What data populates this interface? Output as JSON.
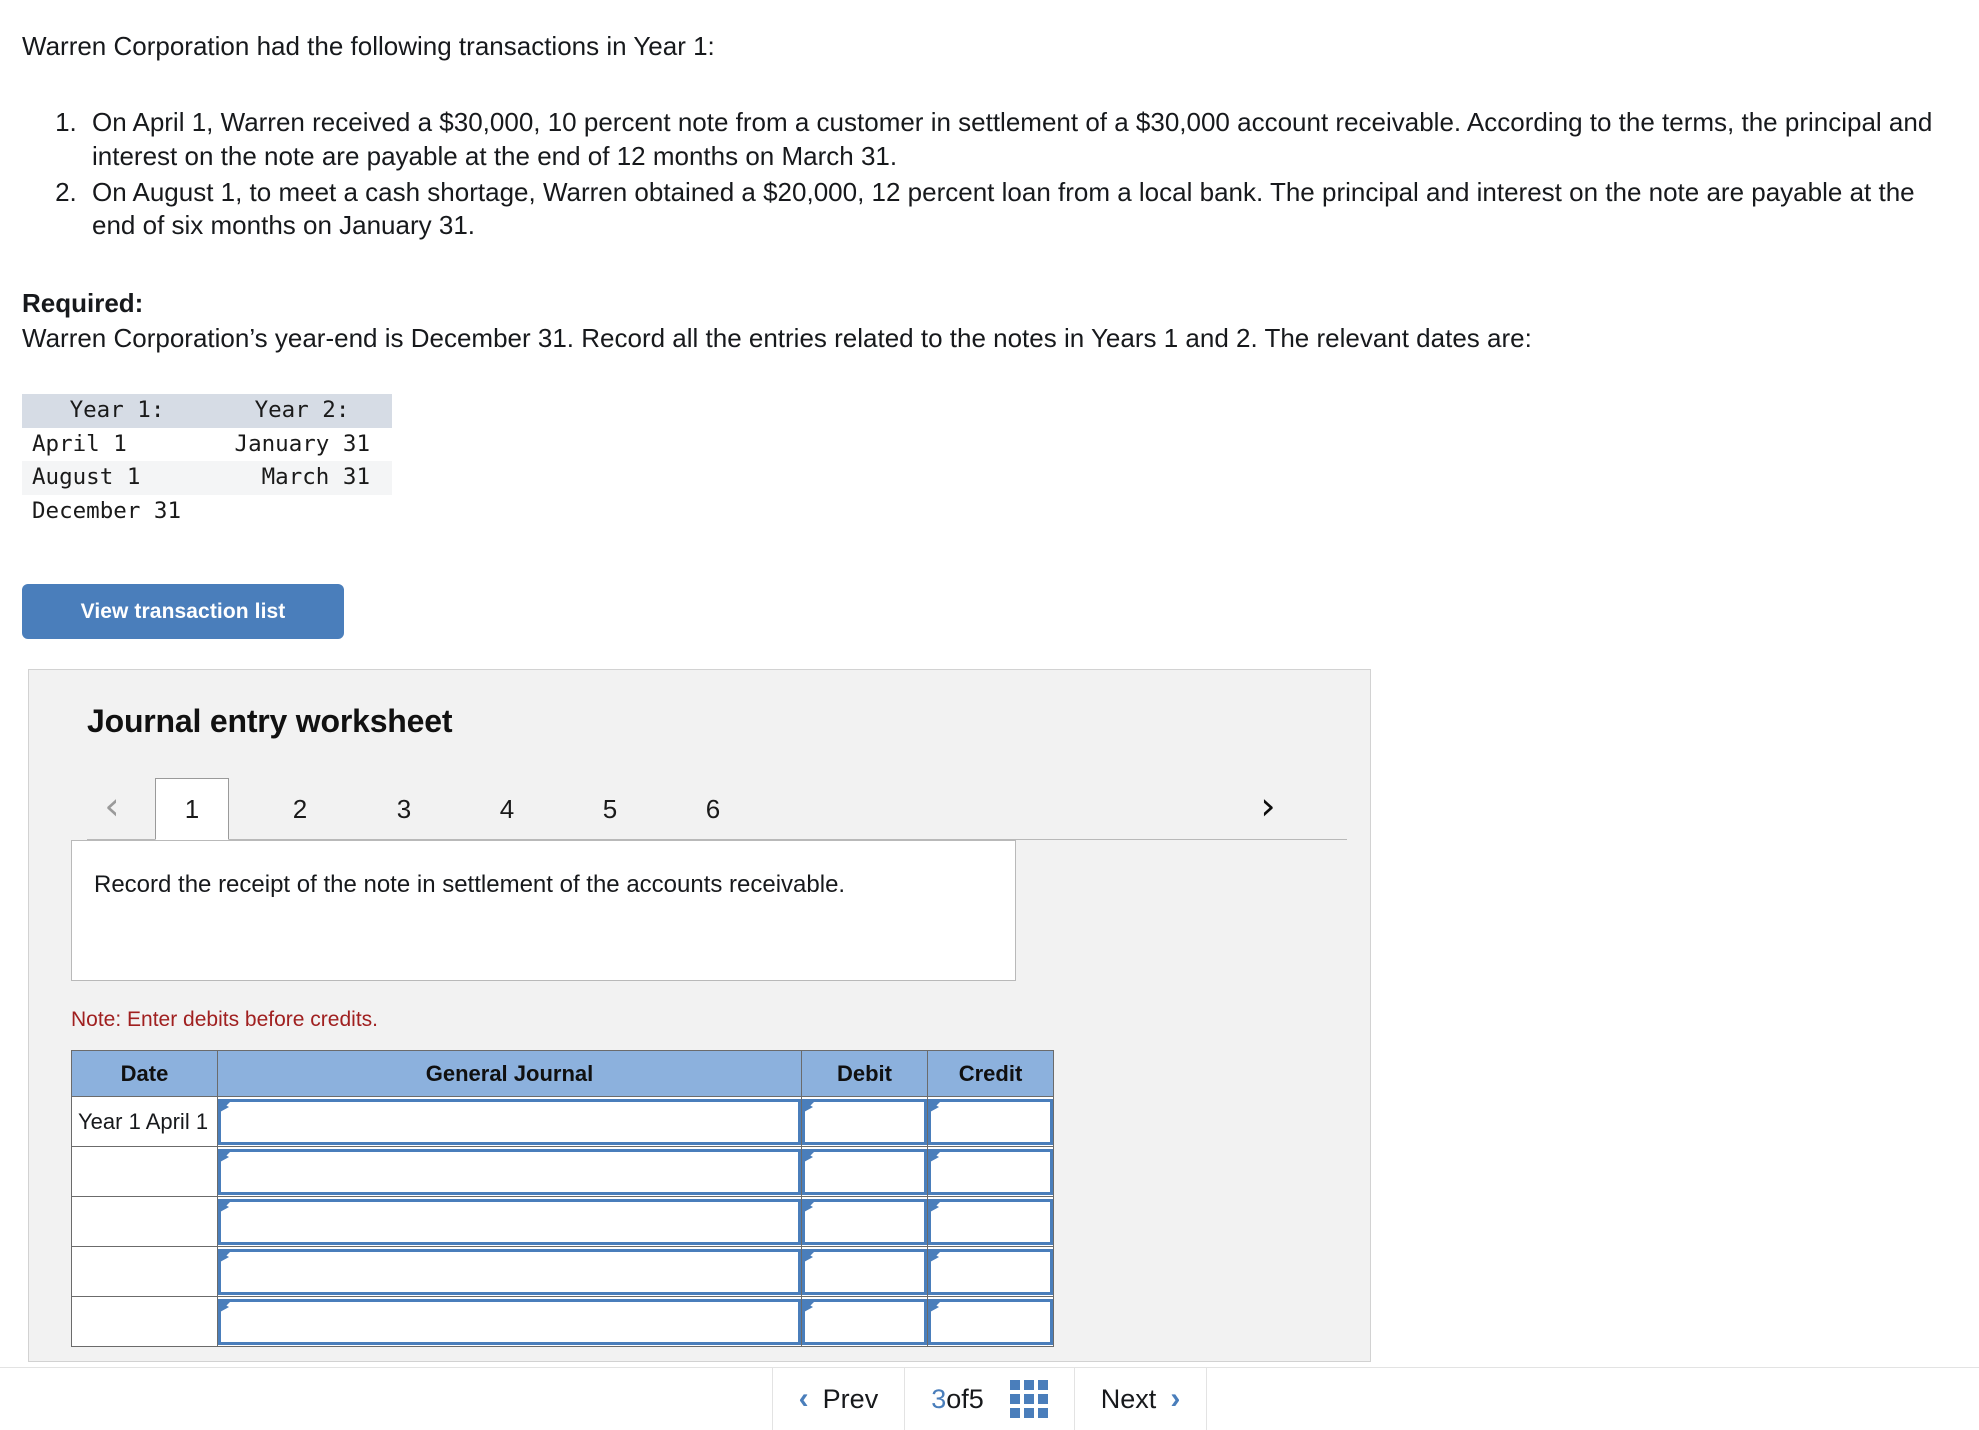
{
  "problem": {
    "intro": "Warren Corporation had the following transactions in Year 1:",
    "transactions": [
      "On April 1, Warren received a $30,000, 10 percent note from a customer in settlement of a $30,000 account receivable. According to the terms, the principal and interest on the note are payable at the end of 12 months on March 31.",
      "On August 1, to meet a cash shortage, Warren obtained a $20,000, 12 percent loan from a local bank. The principal and interest on the note are payable at the end of six months on January 31."
    ],
    "required_label": "Required:",
    "required_text": "Warren Corporation’s year-end is December 31. Record all the entries related to the notes in Years 1 and 2. The relevant dates are:"
  },
  "date_table": {
    "headers": [
      "Year 1:",
      "Year 2:"
    ],
    "rows": [
      [
        "April 1",
        "January 31"
      ],
      [
        "August 1",
        "March 31"
      ],
      [
        "December 31",
        ""
      ]
    ]
  },
  "actions": {
    "view_transaction_list": "View transaction list"
  },
  "worksheet": {
    "title": "Journal entry worksheet",
    "prev_arrow": "‹",
    "next_arrow": "›",
    "tabs": [
      "1",
      "2",
      "3",
      "4",
      "5",
      "6"
    ],
    "active_tab": "1",
    "instruction": "Record the receipt of the note in settlement of the accounts receivable.",
    "note": "Note: Enter debits before credits.",
    "table": {
      "headers": [
        "Date",
        "General Journal",
        "Debit",
        "Credit"
      ],
      "rows": [
        {
          "date": "Year 1 April 1",
          "general_journal": "",
          "debit": "",
          "credit": ""
        },
        {
          "date": "",
          "general_journal": "",
          "debit": "",
          "credit": ""
        },
        {
          "date": "",
          "general_journal": "",
          "debit": "",
          "credit": ""
        },
        {
          "date": "",
          "general_journal": "",
          "debit": "",
          "credit": ""
        },
        {
          "date": "",
          "general_journal": "",
          "debit": "",
          "credit": ""
        }
      ]
    }
  },
  "bottom_bar": {
    "prev_label": "Prev",
    "prev_arrow": "‹",
    "page_current": "3",
    "page_of": " of ",
    "page_total": "5",
    "next_label": "Next",
    "next_arrow": "›"
  },
  "colors": {
    "accent_blue": "#4a7ebb",
    "header_blue": "#8cb1dd",
    "note_red": "#a02020",
    "panel_gray": "#f2f2f2",
    "date_header_gray": "#d6dce5"
  }
}
